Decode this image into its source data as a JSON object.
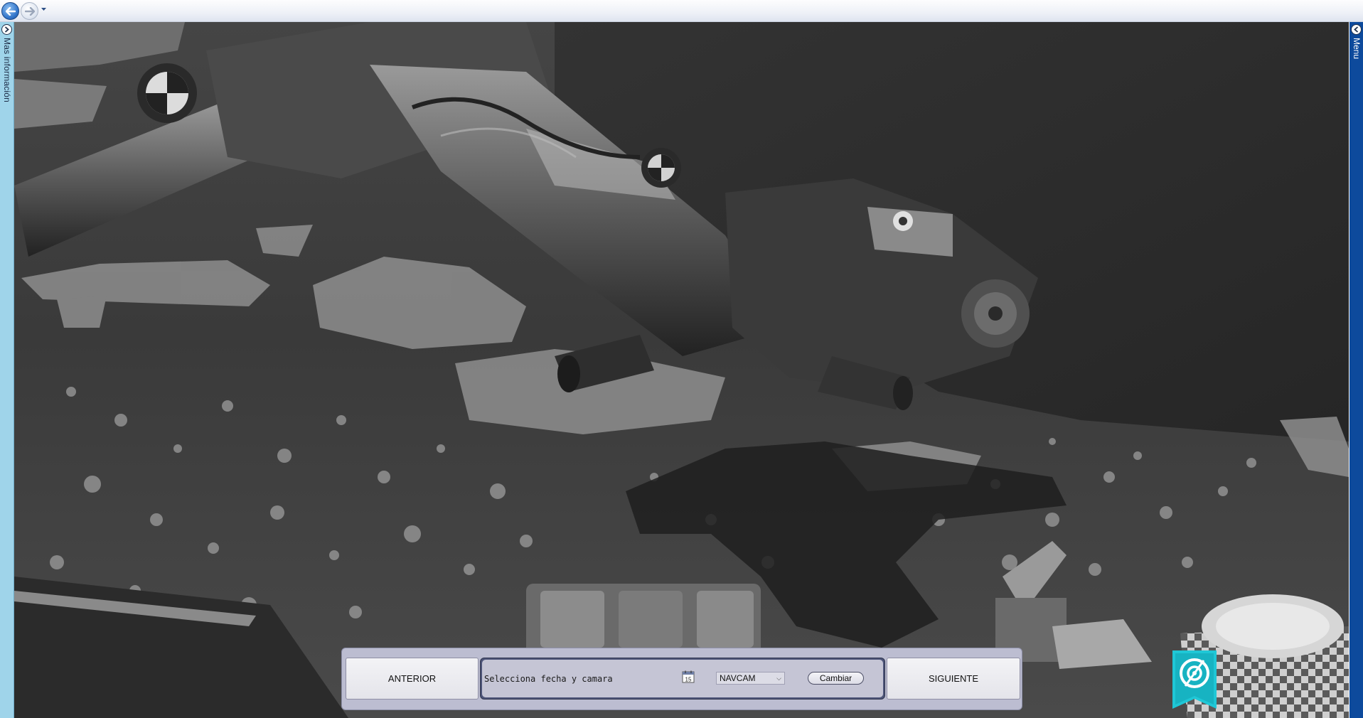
{
  "browser": {
    "back_icon": "back-arrow-icon",
    "forward_icon": "forward-arrow-icon",
    "dropdown_icon": "chevron-down-icon"
  },
  "left_panel": {
    "label": "Mas información",
    "toggle_icon": "chevron-right-icon",
    "color": "#9fd4ea"
  },
  "right_panel": {
    "label": "Menu",
    "toggle_icon": "chevron-left-icon",
    "color": "#0d4a9c"
  },
  "controls": {
    "previous_label": "ANTERIOR",
    "prompt_label": "Selecciona fecha y camara",
    "calendar_icon": "calendar-icon",
    "calendar_day": "15",
    "camera_selected": "NAVCAM",
    "change_label": "Cambiar",
    "next_label": "SIGUIENTE"
  },
  "assistant": {
    "icon": "assistant-badge-icon",
    "color": "#1fc7d6"
  },
  "photo": {
    "subject": "rover-arm-photo"
  }
}
